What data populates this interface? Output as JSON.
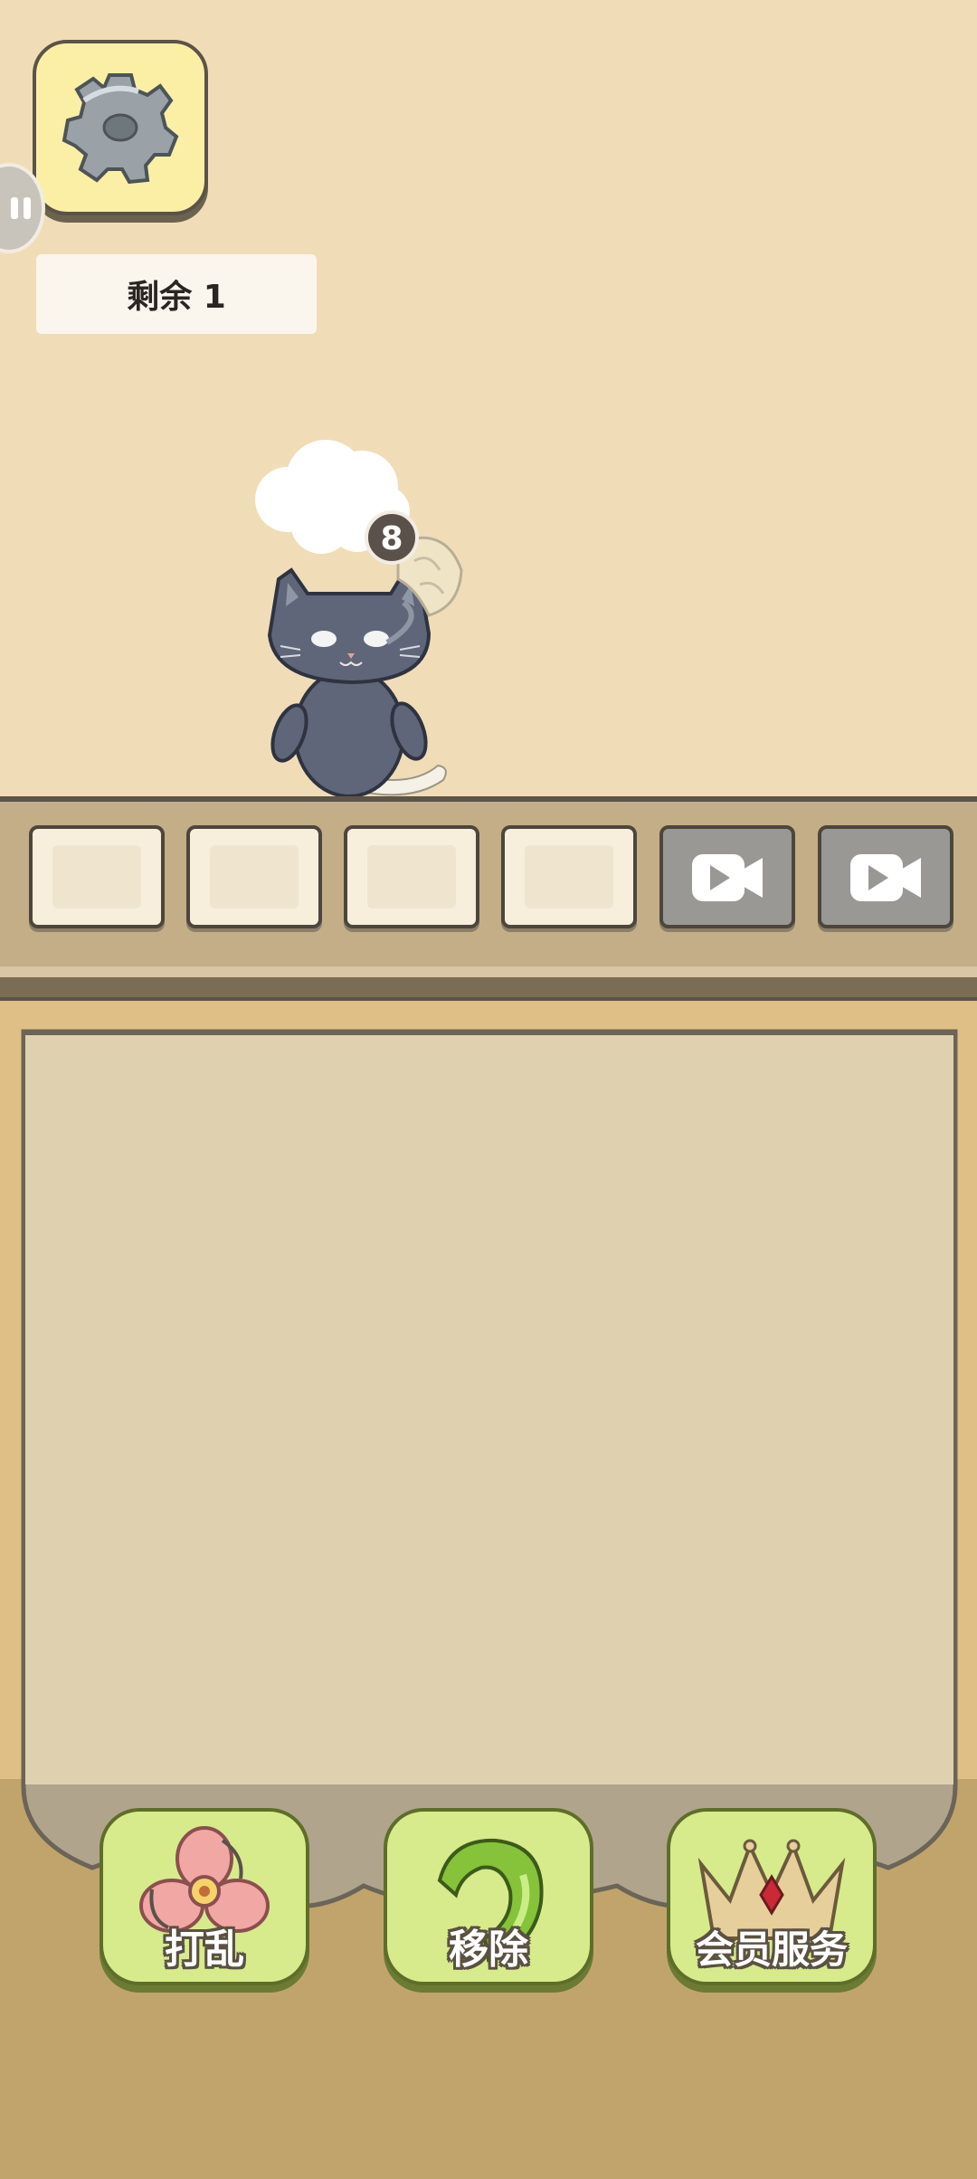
{
  "status": {
    "remaining_text": "剩余 1"
  },
  "character": {
    "bubble_number": "8"
  },
  "slots": [
    {
      "state": "empty"
    },
    {
      "state": "empty"
    },
    {
      "state": "empty"
    },
    {
      "state": "empty"
    },
    {
      "state": "locked-video",
      "icon": "video-camera-icon"
    },
    {
      "state": "locked-video",
      "icon": "video-camera-icon"
    }
  ],
  "tools": {
    "shuffle_label": "打乱",
    "remove_label": "移除",
    "vip_label": "会员服务"
  },
  "icons": {
    "settings": "gear-icon",
    "pause": "pause-icon",
    "shuffle": "pink-pinwheel-icon",
    "remove": "green-hook-icon",
    "vip": "crown-icon"
  },
  "colors": {
    "background": "#f0ddb8",
    "board": "#dfbf86",
    "tool_button": "#d7eb8c"
  }
}
